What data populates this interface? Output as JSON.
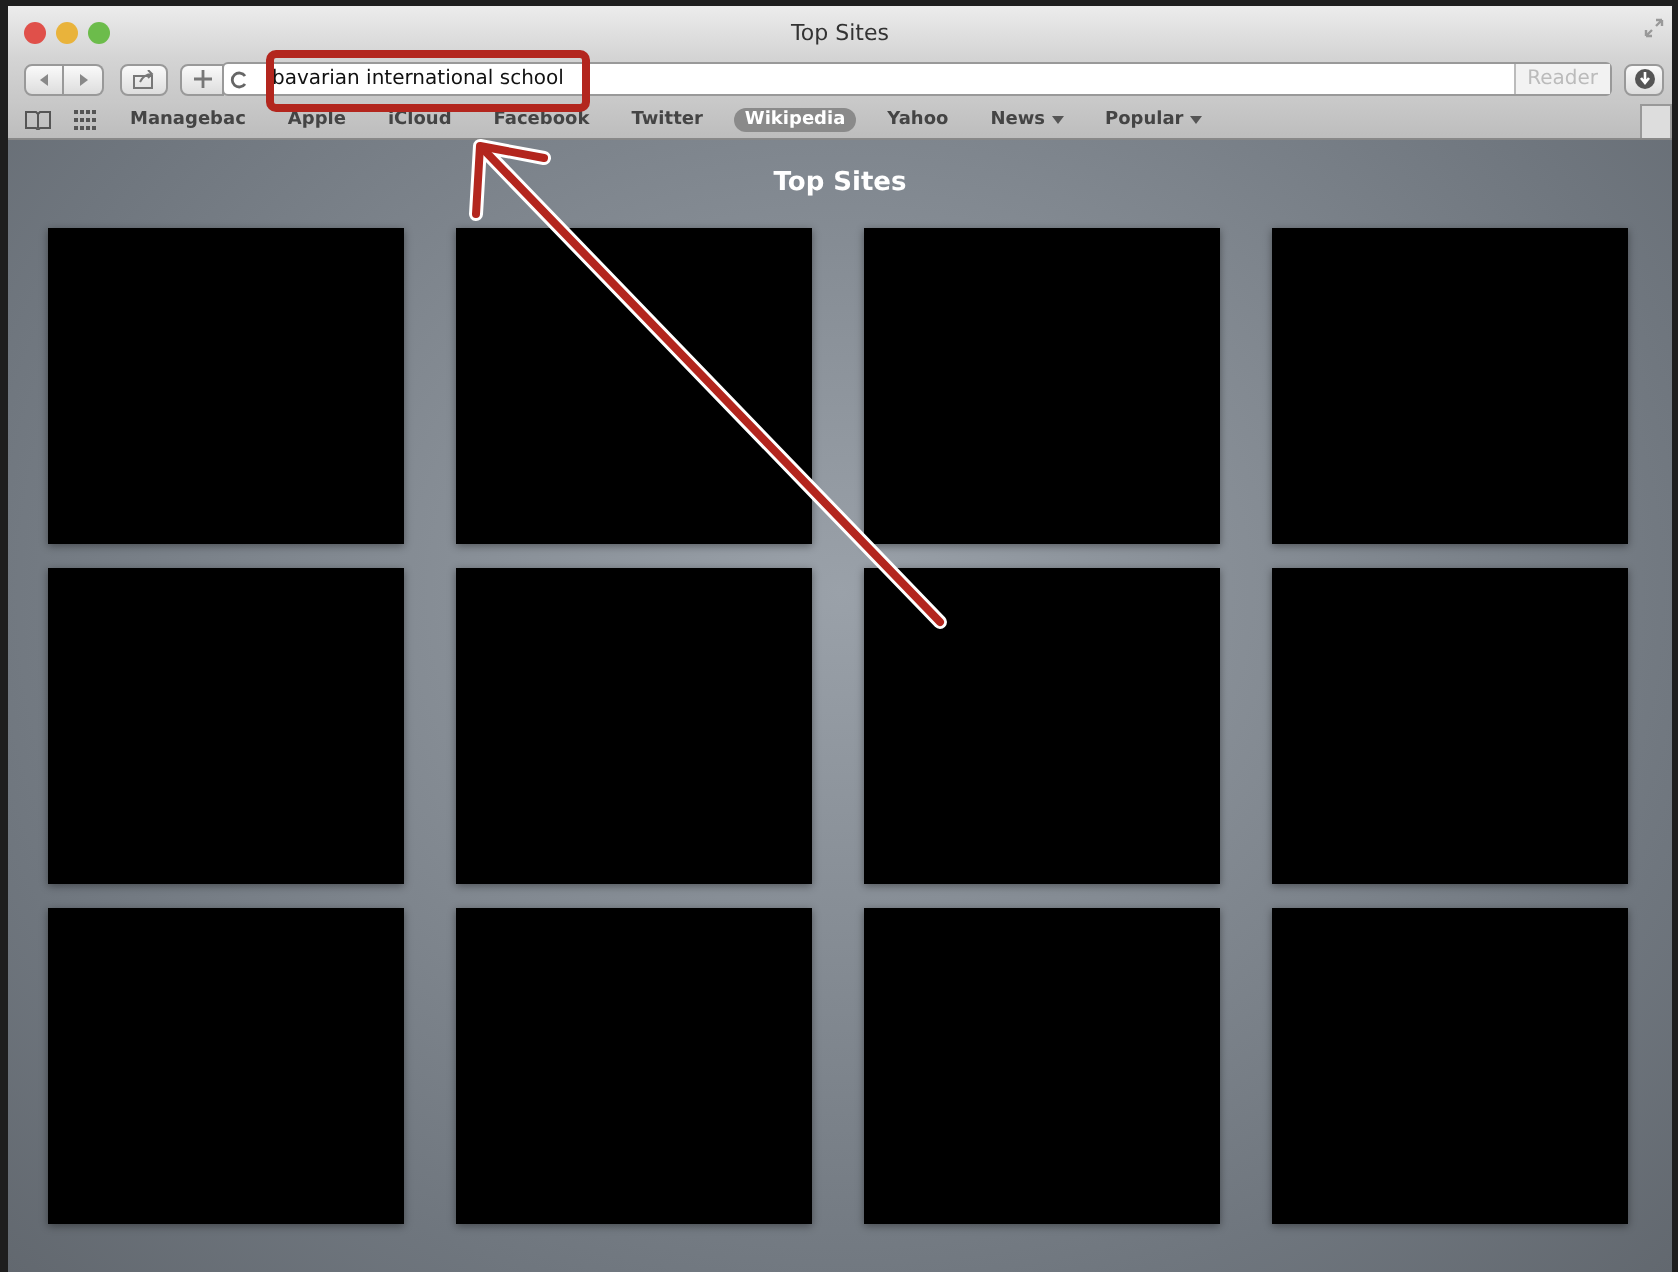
{
  "window": {
    "title": "Top Sites"
  },
  "address_bar": {
    "value": "bavarian international school"
  },
  "reader_button": {
    "label": "Reader",
    "disabled": true
  },
  "bookmarks": [
    {
      "label": "Managebac",
      "kind": "link",
      "selected": false
    },
    {
      "label": "Apple",
      "kind": "link",
      "selected": false
    },
    {
      "label": "iCloud",
      "kind": "link",
      "selected": false
    },
    {
      "label": "Facebook",
      "kind": "link",
      "selected": false
    },
    {
      "label": "Twitter",
      "kind": "link",
      "selected": false
    },
    {
      "label": "Wikipedia",
      "kind": "link",
      "selected": true
    },
    {
      "label": "Yahoo",
      "kind": "link",
      "selected": false
    },
    {
      "label": "News",
      "kind": "menu",
      "selected": false
    },
    {
      "label": "Popular",
      "kind": "menu",
      "selected": false
    }
  ],
  "page": {
    "heading": "Top Sites"
  },
  "tiles": [
    {
      "kind": "thumbnail"
    },
    {
      "kind": "thumbnail"
    },
    {
      "kind": "thumbnail"
    },
    {
      "kind": "thumbnail"
    },
    {
      "kind": "thumbnail"
    },
    {
      "kind": "thumbnail"
    },
    {
      "kind": "thumbnail"
    },
    {
      "kind": "thumbnail"
    },
    {
      "kind": "thumbnail"
    },
    {
      "kind": "thumbnail"
    },
    {
      "kind": "thumbnail"
    },
    {
      "kind": "thumbnail"
    }
  ],
  "annotation": {
    "kind": "box-and-arrow"
  }
}
